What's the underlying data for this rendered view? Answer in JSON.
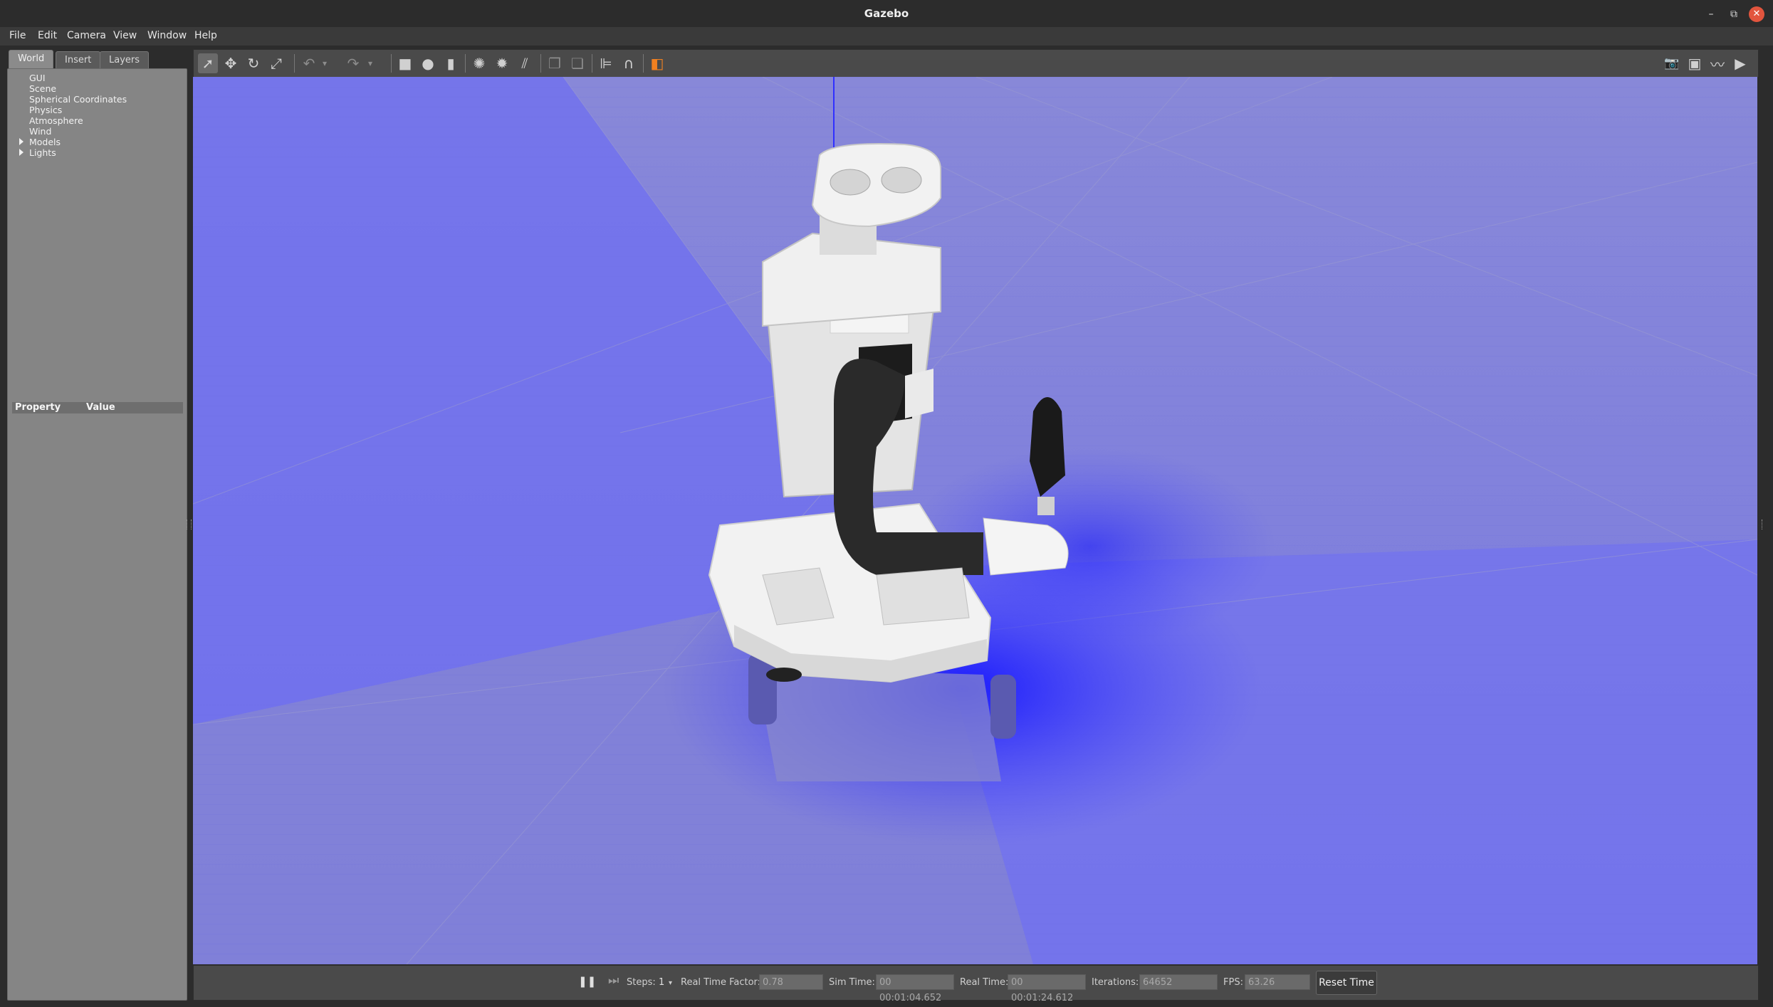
{
  "window": {
    "title": "Gazebo",
    "min_glyph": "–",
    "max_glyph": "⧉",
    "close_glyph": "✕"
  },
  "menubar": {
    "items": [
      {
        "label": "File"
      },
      {
        "label": "Edit"
      },
      {
        "label": "Camera"
      },
      {
        "label": "View"
      },
      {
        "label": "Window"
      },
      {
        "label": "Help"
      }
    ]
  },
  "left_panel": {
    "tabs": [
      {
        "label": "World",
        "active": true
      },
      {
        "label": "Insert",
        "active": false
      },
      {
        "label": "Layers",
        "active": false
      }
    ],
    "tree": [
      {
        "label": "GUI",
        "expandable": false
      },
      {
        "label": "Scene",
        "expandable": false
      },
      {
        "label": "Spherical Coordinates",
        "expandable": false
      },
      {
        "label": "Physics",
        "expandable": false
      },
      {
        "label": "Atmosphere",
        "expandable": false
      },
      {
        "label": "Wind",
        "expandable": false
      },
      {
        "label": "Models",
        "expandable": true
      },
      {
        "label": "Lights",
        "expandable": true
      }
    ],
    "property_header": {
      "property": "Property",
      "value": "Value"
    }
  },
  "toolbar": {
    "left_tools": [
      {
        "name": "select-mode-icon",
        "glyph": "➚",
        "selected": true
      },
      {
        "name": "translate-mode-icon",
        "glyph": "✥"
      },
      {
        "name": "rotate-mode-icon",
        "glyph": "↻"
      },
      {
        "name": "scale-mode-icon",
        "glyph": "⤢"
      },
      {
        "name": "undo-icon",
        "glyph": "↶",
        "dim": true
      },
      {
        "name": "undo-history-icon",
        "glyph": "▾",
        "dim": true
      },
      {
        "name": "redo-icon",
        "glyph": "↷",
        "dim": true
      },
      {
        "name": "redo-history-icon",
        "glyph": "▾",
        "dim": true
      },
      {
        "name": "box-shape-icon",
        "glyph": "■"
      },
      {
        "name": "sphere-shape-icon",
        "glyph": "●"
      },
      {
        "name": "cylinder-shape-icon",
        "glyph": "▮"
      },
      {
        "name": "point-light-icon",
        "glyph": "✺"
      },
      {
        "name": "spot-light-icon",
        "glyph": "✹"
      },
      {
        "name": "directional-light-icon",
        "glyph": "⫽"
      },
      {
        "name": "copy-icon",
        "glyph": "❐",
        "dim": true
      },
      {
        "name": "paste-icon",
        "glyph": "❏",
        "dim": true
      },
      {
        "name": "align-icon",
        "glyph": "⊫"
      },
      {
        "name": "snap-icon",
        "glyph": "∩"
      },
      {
        "name": "view-angle-icon",
        "glyph": "◧",
        "accent": "#f08020"
      }
    ],
    "right_tools": [
      {
        "name": "screenshot-icon",
        "glyph": "📷"
      },
      {
        "name": "log-record-icon",
        "glyph": "▣"
      },
      {
        "name": "plot-icon",
        "glyph": "〰"
      },
      {
        "name": "video-record-icon",
        "glyph": "▶"
      }
    ]
  },
  "viewport": {
    "sky_color": "#7d7dd6",
    "ground_color": "#7070ee",
    "axis_color": "#4040ff",
    "highlight_color": "#2020ff"
  },
  "statusbar": {
    "pause_glyph": "❚❚",
    "step_glyph": "⏭",
    "steps_label": "Steps:",
    "steps_value": "1",
    "rtf_label": "Real Time Factor:",
    "rtf_value": "0.78",
    "sim_time_label": "Sim Time:",
    "sim_time_value": "00 00:01:04.652",
    "real_time_label": "Real Time:",
    "real_time_value": "00 00:01:24.612",
    "iterations_label": "Iterations:",
    "iterations_value": "64652",
    "fps_label": "FPS:",
    "fps_value": "63.26",
    "reset_label": "Reset Time"
  }
}
